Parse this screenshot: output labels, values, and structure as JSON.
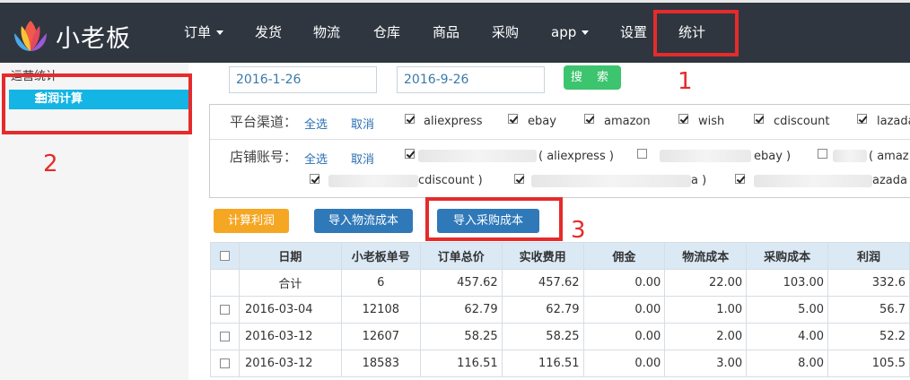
{
  "header": {
    "brand": "小老板",
    "nav": [
      "订单",
      "发货",
      "物流",
      "仓库",
      "商品",
      "采购",
      "app",
      "设置",
      "统计"
    ]
  },
  "annotations": [
    "1",
    "2",
    "3"
  ],
  "sidebar": {
    "heading": "运营统计",
    "active_item": "利润计算"
  },
  "filters": {
    "start_date": "2016-1-26",
    "end_date": "2016-9-26",
    "search_label": "搜 索",
    "platform_label": "平台渠道：",
    "store_label": "店铺账号：",
    "select_all": "全选",
    "cancel": "取消",
    "platforms": [
      "aliexpress",
      "ebay",
      "amazon",
      "wish",
      "cdiscount",
      "lazada"
    ],
    "stores": [
      "( aliexpress )",
      "ebay )",
      "( amaz",
      "cdiscount )",
      "a )",
      "azada"
    ]
  },
  "actions": {
    "calc": "计算利润",
    "import_logistics": "导入物流成本",
    "import_purchase": "导入采购成本"
  },
  "colors": {
    "nav_bg": "#2f3640",
    "accent_blue": "#14b4e4",
    "search_green": "#3cc46e",
    "calc_orange": "#f5a623",
    "btn_blue": "#2f79b9",
    "annotation_red": "#e52b2b"
  },
  "table": {
    "headers": [
      "日期",
      "小老板单号",
      "订单总价",
      "实收费用",
      "佣金",
      "物流成本",
      "采购成本",
      "利润"
    ],
    "total": [
      "合计",
      "6",
      "457.62",
      "457.62",
      "0.00",
      "22.00",
      "103.00",
      "332.6"
    ],
    "rows": [
      [
        "2016-03-04",
        "12108",
        "62.79",
        "62.79",
        "0.00",
        "1.00",
        "5.00",
        "56.7"
      ],
      [
        "2016-03-12",
        "12607",
        "58.25",
        "58.25",
        "0.00",
        "2.00",
        "4.00",
        "52.2"
      ],
      [
        "2016-03-12",
        "18583",
        "116.51",
        "116.51",
        "0.00",
        "3.00",
        "8.00",
        "105.5"
      ]
    ]
  }
}
